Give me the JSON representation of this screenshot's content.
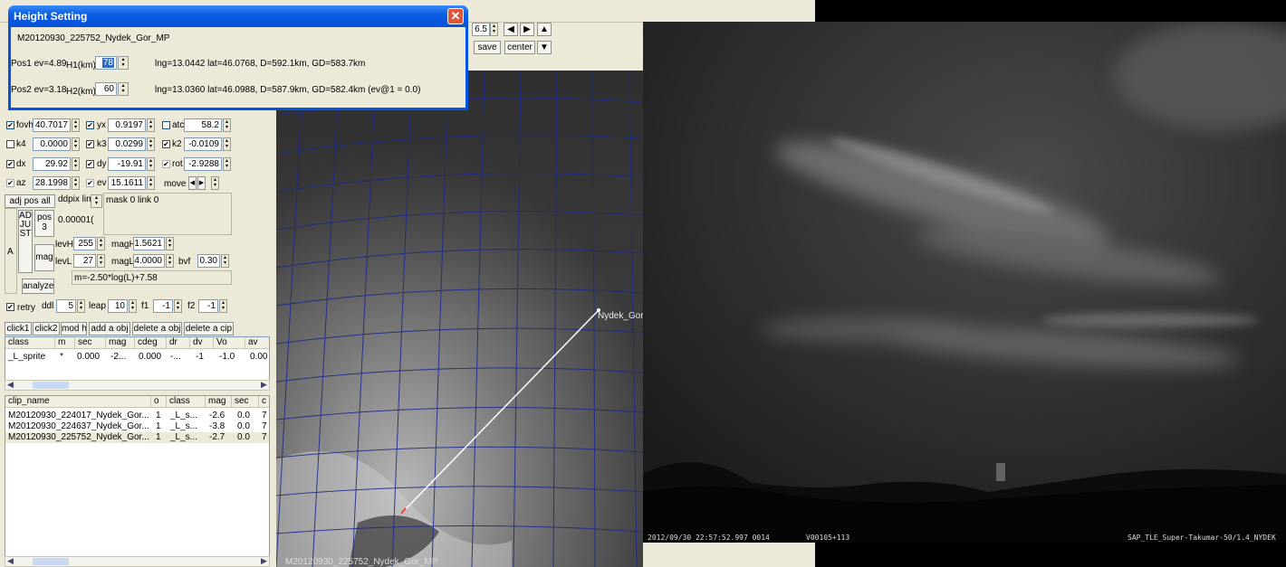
{
  "dialog": {
    "title": "Height Setting",
    "clip_name": "M20120930_225752_Nydek_Gor_MP",
    "pos1_label": "Pos1 ev=4.89",
    "h1_label": "H1(km)",
    "h1_value": "78",
    "pos1_info": "lng=13.0442 lat=46.0768, D=592.1km, GD=583.7km",
    "pos2_label": "Pos2 ev=3.18",
    "h2_label": "H2(km)",
    "h2_value": "60",
    "pos2_info": "lng=13.0360 lat=46.0988, D=587.9km, GD=582.4km  (ev@1 = 0.0)"
  },
  "top_controls": {
    "zoom_value": "6.5",
    "save_label": "save",
    "center_label": "center"
  },
  "params": {
    "fovh_label": "fovh",
    "fovh_value": "40.7017",
    "yx_label": "yx",
    "yx_value": "0.9197",
    "atc_label": "atc",
    "atc_value": "58.2",
    "k4_label": "k4",
    "k4_value": "0.0000",
    "k3_label": "k3",
    "k3_value": "0.0299",
    "k2_label": "k2",
    "k2_value": "-0.0109",
    "dx_label": "dx",
    "dx_value": "29.92",
    "dy_label": "dy",
    "dy_value": "-19.91",
    "rot_label": "rot",
    "rot_value": "-2.9288",
    "az_label": "az",
    "az_value": "28.1998",
    "ev_label": "ev",
    "ev_value": "15.1611",
    "move_label": "move"
  },
  "adjust": {
    "adj_pos_all": "adj pos all",
    "ddpix_label": "ddpix lim",
    "mask_link": "mask 0  link 0",
    "adjust_vertical": "ADJUST",
    "a_label": "A",
    "pos3_label": "pos 3",
    "pos_value": "0.00001(",
    "mag_label": "mag",
    "analyze_label": "analyze",
    "levH_label": "levH",
    "levH_value": "255",
    "magH_label": "magH",
    "magH_value": "1.5621",
    "levL_label": "levL",
    "levL_value": "27",
    "magL_label": "magL",
    "magL_value": "4.0000",
    "bvf_label": "bvf",
    "bvf_value": "0.30",
    "formula": "m=-2.50*log(L)+7.58"
  },
  "retry_row": {
    "retry_label": "retry",
    "ddl_label": "ddl",
    "ddl_value": "5",
    "leap_label": "leap",
    "leap_value": "10",
    "f1_label": "f1",
    "f1_value": "-1",
    "f2_label": "f2",
    "f2_value": "-1"
  },
  "action_buttons": [
    "click1",
    "click2",
    "mod h",
    "add a obj",
    "delete a obj",
    "delete a cip"
  ],
  "obj_table": {
    "headers": [
      "class",
      "m",
      "sec",
      "mag",
      "cdeg",
      "dr",
      "dv",
      "Vo",
      "av"
    ],
    "rows": [
      [
        "_L_sprite",
        "*",
        "0.000",
        "-2...",
        "0.000",
        "-...",
        "-1",
        "-1.0",
        "0.00"
      ]
    ]
  },
  "clip_table": {
    "headers": [
      "clip_name",
      "o",
      "class",
      "mag",
      "sec",
      "c"
    ],
    "rows": [
      [
        "M20120930_224017_Nydek_Gor...",
        "1",
        "_L_s...",
        "-2.6",
        "0.0",
        "7"
      ],
      [
        "M20120930_224637_Nydek_Gor...",
        "1",
        "_L_s...",
        "-3.8",
        "0.0",
        "7"
      ],
      [
        "M20120930_225752_Nydek_Gor...",
        "1",
        "_L_s...",
        "-2.7",
        "0.0",
        "7"
      ]
    ]
  },
  "map": {
    "station_label": "Nydek_Gor",
    "footer": "M20120930_225752_Nydek_Gor_MP"
  },
  "camera": {
    "timestamp": "2012/09/30 22:57:52.997 0014",
    "frame_code": "V00105+113",
    "lens_station": "SAP_TLE_Super-Takumar-50/1.4_NYDEK"
  }
}
